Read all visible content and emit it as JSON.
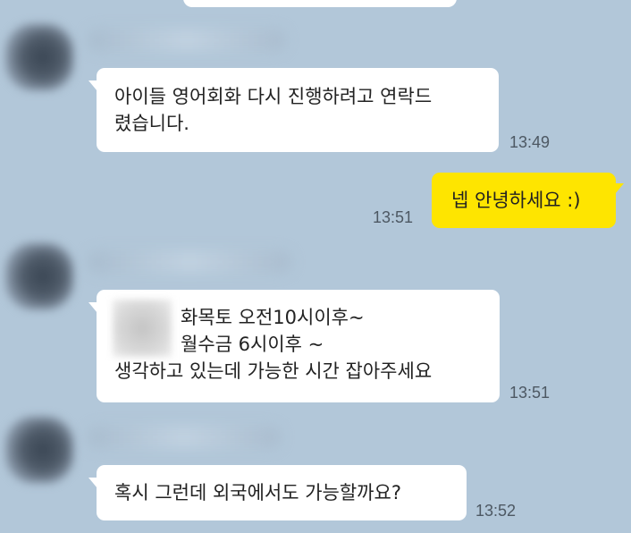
{
  "messages": [
    {
      "sender": "other",
      "lines": [
        "아이들 영어회화 다시 진행하려고 연락드",
        "렸습니다."
      ],
      "time": "13:49"
    },
    {
      "sender": "me",
      "lines": [
        "넵 안녕하세요 :)"
      ],
      "time": "13:51"
    },
    {
      "sender": "other",
      "lines": [
        "화목토 오전10시이후~",
        "월수금 6시이후 ~",
        "생각하고 있는데 가능한 시간 잡아주세요"
      ],
      "time": "13:51"
    },
    {
      "sender": "other",
      "lines": [
        "혹시 그런데 외국에서도 가능할까요?"
      ],
      "time": "13:52"
    }
  ],
  "colors": {
    "background": "#b2c7d9",
    "other_bubble": "#ffffff",
    "my_bubble": "#fee500",
    "timestamp": "#4d5863"
  },
  "icons": {
    "avatar": "blurred-profile-photo",
    "sender_name": "blurred-sender-name",
    "redacted_image": "blurred-inline-image"
  }
}
